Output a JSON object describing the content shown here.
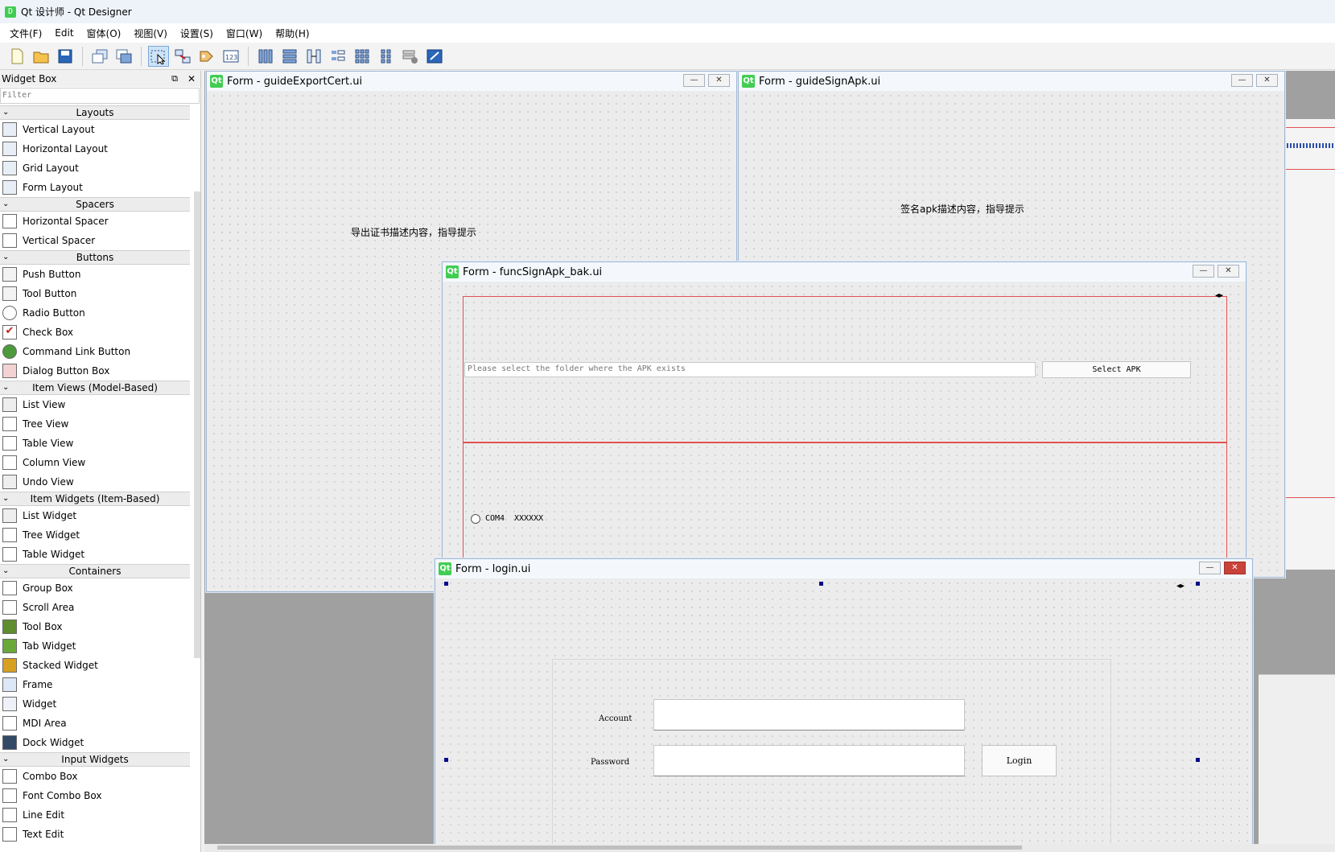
{
  "app": {
    "icon": "D",
    "title": "Qt 设计师 - Qt Designer"
  },
  "menubar": [
    "文件(F)",
    "Edit",
    "窗体(O)",
    "视图(V)",
    "设置(S)",
    "窗口(W)",
    "帮助(H)"
  ],
  "toolbar": {
    "buttons": [
      "new-form-icon",
      "open-form-icon",
      "save-form-icon",
      "send-to-back-icon",
      "bring-to-front-icon",
      "edit-widgets-icon",
      "edit-signals-slots-icon",
      "edit-buddies-icon",
      "edit-tab-order-icon",
      "lay-out-horizontally-icon",
      "lay-out-vertically-icon",
      "lay-out-splitter-icon",
      "lay-out-form-icon",
      "lay-out-grid-icon",
      "lay-out-grid-alt-icon",
      "break-layout-icon",
      "adjust-size-icon"
    ]
  },
  "widget_box": {
    "title": "Widget Box",
    "filter_placeholder": "Filter",
    "categories": [
      {
        "name": "Layouts",
        "items": [
          "Vertical Layout",
          "Horizontal Layout",
          "Grid Layout",
          "Form Layout"
        ]
      },
      {
        "name": "Spacers",
        "items": [
          "Horizontal Spacer",
          "Vertical Spacer"
        ]
      },
      {
        "name": "Buttons",
        "items": [
          "Push Button",
          "Tool Button",
          "Radio Button",
          "Check Box",
          "Command Link Button",
          "Dialog Button Box"
        ]
      },
      {
        "name": "Item Views (Model-Based)",
        "items": [
          "List View",
          "Tree View",
          "Table View",
          "Column View",
          "Undo View"
        ]
      },
      {
        "name": "Item Widgets (Item-Based)",
        "items": [
          "List Widget",
          "Tree Widget",
          "Table Widget"
        ]
      },
      {
        "name": "Containers",
        "items": [
          "Group Box",
          "Scroll Area",
          "Tool Box",
          "Tab Widget",
          "Stacked Widget",
          "Frame",
          "Widget",
          "MDI Area",
          "Dock Widget"
        ]
      },
      {
        "name": "Input Widgets",
        "items": [
          "Combo Box",
          "Font Combo Box",
          "Line Edit",
          "Text Edit"
        ]
      }
    ]
  },
  "forms": {
    "export_cert": {
      "title": "Form - guideExportCert.ui",
      "label": "导出证书描述内容，指导提示"
    },
    "sign_apk": {
      "title": "Form - guideSignApk.ui",
      "label": "签名apk描述内容，指导提示"
    },
    "func_sign_apk": {
      "title": "Form - funcSignApk_bak.ui",
      "folder_placeholder": "Please select the folder where the APK exists",
      "select_button": "Select APK",
      "radio_label": "COM4",
      "radio_value": "XXXXXX"
    },
    "login": {
      "title": "Form - login.ui",
      "account_label": "Account",
      "password_label": "Password",
      "login_button": "Login"
    }
  },
  "window_controls": {
    "minimize": "—",
    "close": "✕"
  }
}
